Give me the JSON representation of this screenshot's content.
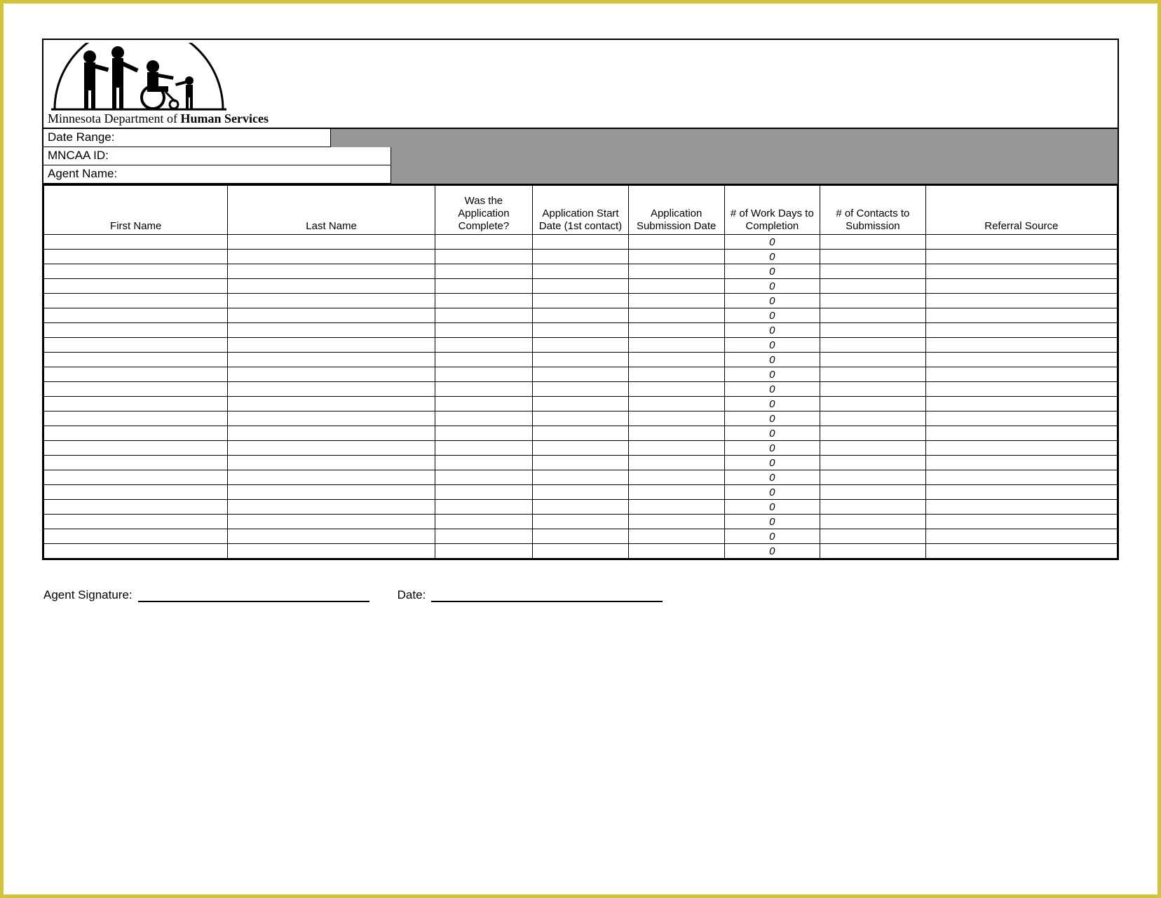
{
  "logo": {
    "caption_prefix": "Minnesota Department of ",
    "caption_bold": "Human Services"
  },
  "info": {
    "date_range_label": "Date Range:",
    "mncaa_id_label": "MNCAA ID:",
    "agent_name_label": "Agent Name:"
  },
  "columns": {
    "first_name": "First Name",
    "last_name": "Last Name",
    "complete": "Was the Application Complete?",
    "start_date": "Application Start Date (1st contact)",
    "submission_date": "Application Submission Date",
    "work_days": "# of Work Days to Completion",
    "contacts": "# of Contacts to Submission",
    "referral": "Referral Source"
  },
  "rows": [
    {
      "first": "",
      "last": "",
      "complete": "",
      "start": "",
      "submit": "",
      "workdays": "0",
      "contacts": "",
      "referral": ""
    },
    {
      "first": "",
      "last": "",
      "complete": "",
      "start": "",
      "submit": "",
      "workdays": "0",
      "contacts": "",
      "referral": ""
    },
    {
      "first": "",
      "last": "",
      "complete": "",
      "start": "",
      "submit": "",
      "workdays": "0",
      "contacts": "",
      "referral": ""
    },
    {
      "first": "",
      "last": "",
      "complete": "",
      "start": "",
      "submit": "",
      "workdays": "0",
      "contacts": "",
      "referral": ""
    },
    {
      "first": "",
      "last": "",
      "complete": "",
      "start": "",
      "submit": "",
      "workdays": "0",
      "contacts": "",
      "referral": ""
    },
    {
      "first": "",
      "last": "",
      "complete": "",
      "start": "",
      "submit": "",
      "workdays": "0",
      "contacts": "",
      "referral": ""
    },
    {
      "first": "",
      "last": "",
      "complete": "",
      "start": "",
      "submit": "",
      "workdays": "0",
      "contacts": "",
      "referral": ""
    },
    {
      "first": "",
      "last": "",
      "complete": "",
      "start": "",
      "submit": "",
      "workdays": "0",
      "contacts": "",
      "referral": ""
    },
    {
      "first": "",
      "last": "",
      "complete": "",
      "start": "",
      "submit": "",
      "workdays": "0",
      "contacts": "",
      "referral": ""
    },
    {
      "first": "",
      "last": "",
      "complete": "",
      "start": "",
      "submit": "",
      "workdays": "0",
      "contacts": "",
      "referral": ""
    },
    {
      "first": "",
      "last": "",
      "complete": "",
      "start": "",
      "submit": "",
      "workdays": "0",
      "contacts": "",
      "referral": ""
    },
    {
      "first": "",
      "last": "",
      "complete": "",
      "start": "",
      "submit": "",
      "workdays": "0",
      "contacts": "",
      "referral": ""
    },
    {
      "first": "",
      "last": "",
      "complete": "",
      "start": "",
      "submit": "",
      "workdays": "0",
      "contacts": "",
      "referral": ""
    },
    {
      "first": "",
      "last": "",
      "complete": "",
      "start": "",
      "submit": "",
      "workdays": "0",
      "contacts": "",
      "referral": ""
    },
    {
      "first": "",
      "last": "",
      "complete": "",
      "start": "",
      "submit": "",
      "workdays": "0",
      "contacts": "",
      "referral": ""
    },
    {
      "first": "",
      "last": "",
      "complete": "",
      "start": "",
      "submit": "",
      "workdays": "0",
      "contacts": "",
      "referral": ""
    },
    {
      "first": "",
      "last": "",
      "complete": "",
      "start": "",
      "submit": "",
      "workdays": "0",
      "contacts": "",
      "referral": ""
    },
    {
      "first": "",
      "last": "",
      "complete": "",
      "start": "",
      "submit": "",
      "workdays": "0",
      "contacts": "",
      "referral": ""
    },
    {
      "first": "",
      "last": "",
      "complete": "",
      "start": "",
      "submit": "",
      "workdays": "0",
      "contacts": "",
      "referral": ""
    },
    {
      "first": "",
      "last": "",
      "complete": "",
      "start": "",
      "submit": "",
      "workdays": "0",
      "contacts": "",
      "referral": ""
    },
    {
      "first": "",
      "last": "",
      "complete": "",
      "start": "",
      "submit": "",
      "workdays": "0",
      "contacts": "",
      "referral": ""
    },
    {
      "first": "",
      "last": "",
      "complete": "",
      "start": "",
      "submit": "",
      "workdays": "0",
      "contacts": "",
      "referral": ""
    }
  ],
  "signature": {
    "agent_label": "Agent Signature:",
    "date_label": "Date:"
  }
}
